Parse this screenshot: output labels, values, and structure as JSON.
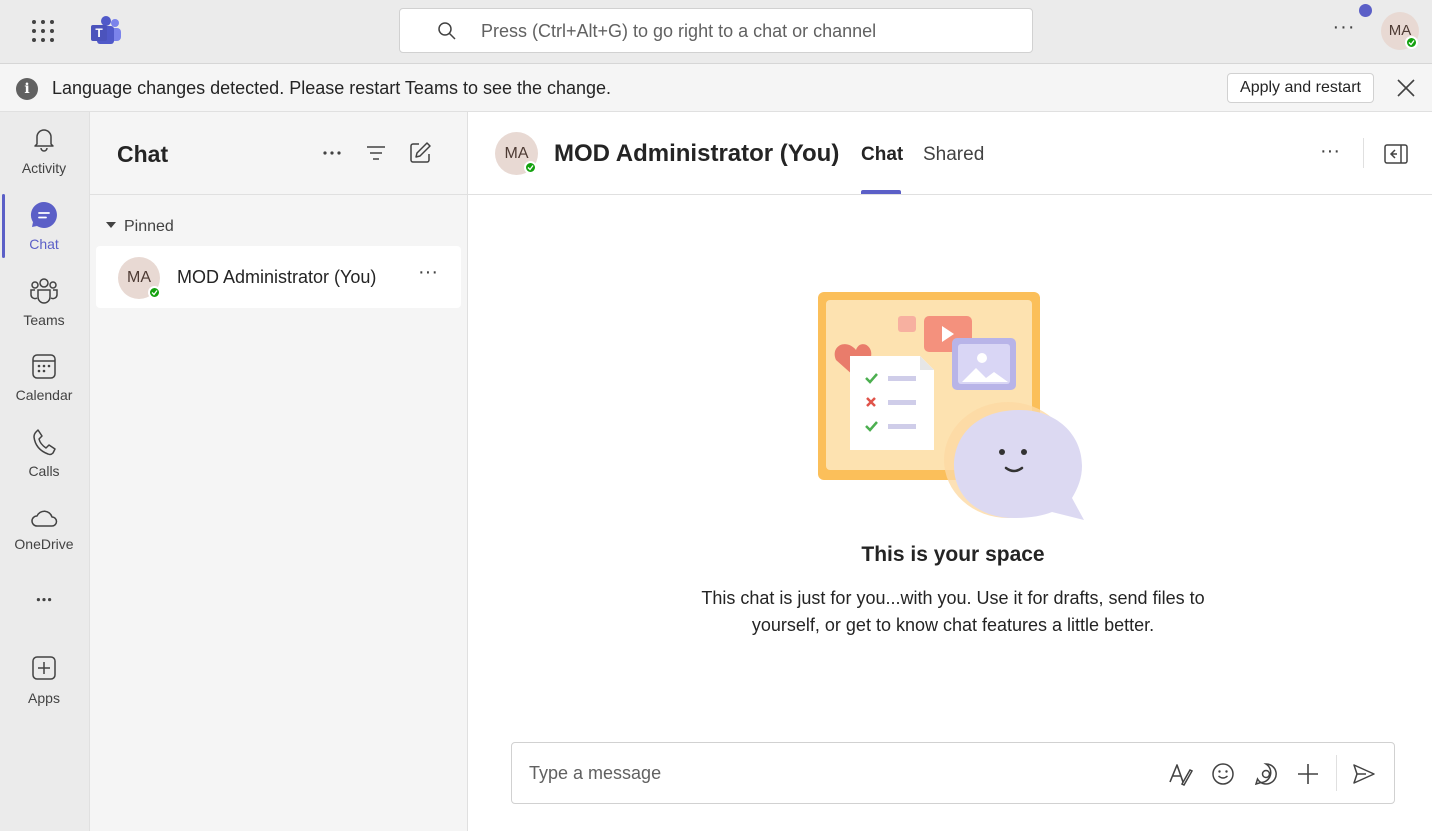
{
  "titlebar": {
    "search_placeholder": "Press (Ctrl+Alt+G) to go right to a chat or channel",
    "avatar_initials": "MA"
  },
  "banner": {
    "message": "Language changes detected. Please restart Teams to see the change.",
    "apply_label": "Apply and restart"
  },
  "rail": {
    "items": [
      {
        "label": "Activity",
        "icon": "bell-icon"
      },
      {
        "label": "Chat",
        "icon": "chat-icon"
      },
      {
        "label": "Teams",
        "icon": "teams-icon"
      },
      {
        "label": "Calendar",
        "icon": "calendar-icon"
      },
      {
        "label": "Calls",
        "icon": "phone-icon"
      },
      {
        "label": "OneDrive",
        "icon": "cloud-icon"
      },
      {
        "label": "",
        "icon": "more-icon"
      },
      {
        "label": "Apps",
        "icon": "add-app-icon"
      }
    ],
    "active": "Chat"
  },
  "chat_list": {
    "title": "Chat",
    "section_label": "Pinned",
    "items": [
      {
        "name": "MOD Administrator (You)",
        "initials": "MA",
        "presence": "available"
      }
    ]
  },
  "conversation": {
    "initials": "MA",
    "name": "MOD Administrator (You)",
    "tabs": [
      {
        "label": "Chat",
        "active": true
      },
      {
        "label": "Shared",
        "active": false
      }
    ],
    "empty_title": "This is your space",
    "empty_text": "This chat is just for you...with you. Use it for drafts, send files to yourself, or get to know chat features a little better.",
    "compose_placeholder": "Type a message"
  },
  "colors": {
    "accent": "#5b5fc7",
    "presence_available": "#13a10e",
    "rail_background": "#ebebeb",
    "list_background": "#f5f5f5"
  }
}
